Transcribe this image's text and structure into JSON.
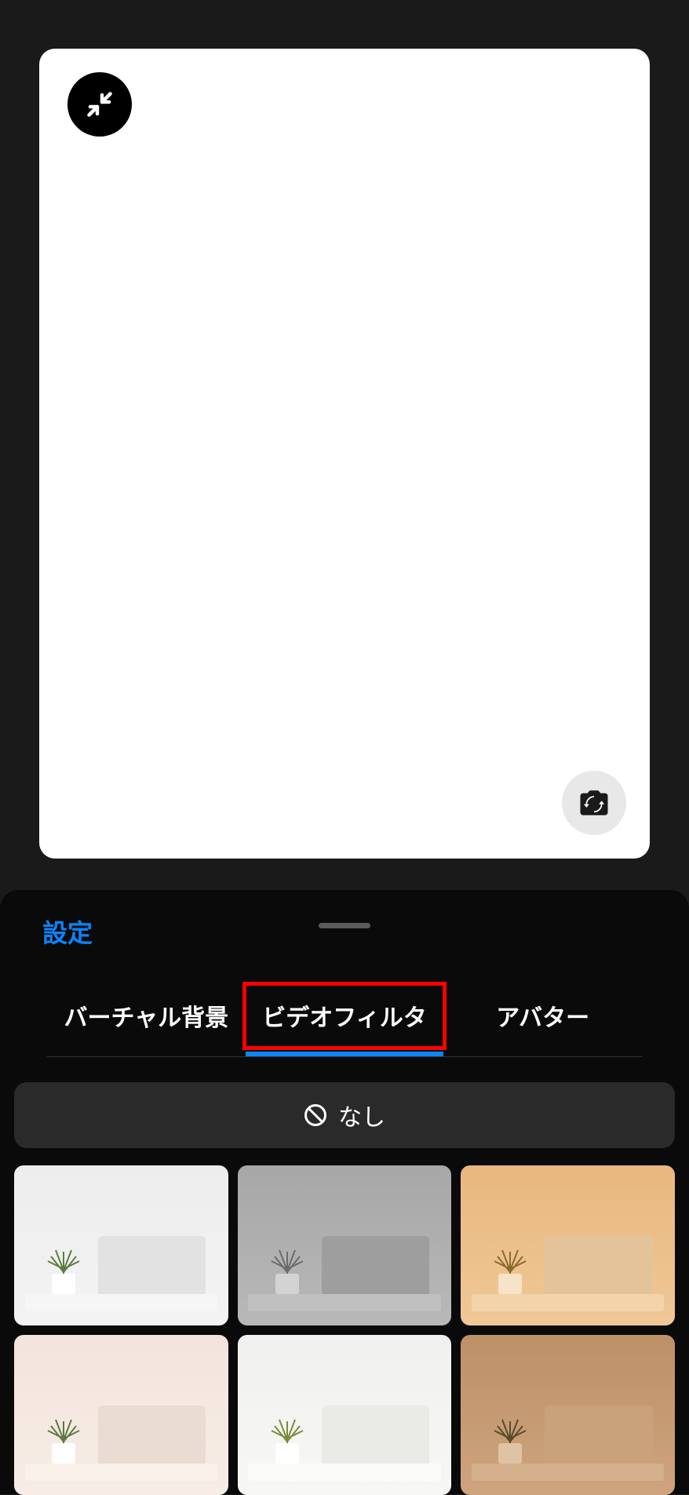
{
  "settings": {
    "title": "設定"
  },
  "tabs": [
    {
      "label": "バーチャル背景",
      "active": false,
      "highlighted": false
    },
    {
      "label": "ビデオフィルタ",
      "active": true,
      "highlighted": true
    },
    {
      "label": "アバター",
      "active": false,
      "highlighted": false
    }
  ],
  "none_button": {
    "label": "なし"
  },
  "icons": {
    "minimize": "minimize-icon",
    "camera_switch": "camera-switch-icon",
    "none": "prohibit-icon"
  },
  "filters": [
    {
      "name": "filter-normal",
      "variant": "f1",
      "leafColor": "#5d7a42"
    },
    {
      "name": "filter-mono",
      "variant": "f2",
      "leafColor": "#6b6b6b"
    },
    {
      "name": "filter-warm",
      "variant": "f3",
      "leafColor": "#8a6a2e"
    },
    {
      "name": "filter-soft",
      "variant": "f4",
      "leafColor": "#5d7a42"
    },
    {
      "name": "filter-bright",
      "variant": "f5",
      "leafColor": "#7a8c3a"
    },
    {
      "name": "filter-sepia",
      "variant": "f6",
      "leafColor": "#5a4a2a"
    }
  ]
}
